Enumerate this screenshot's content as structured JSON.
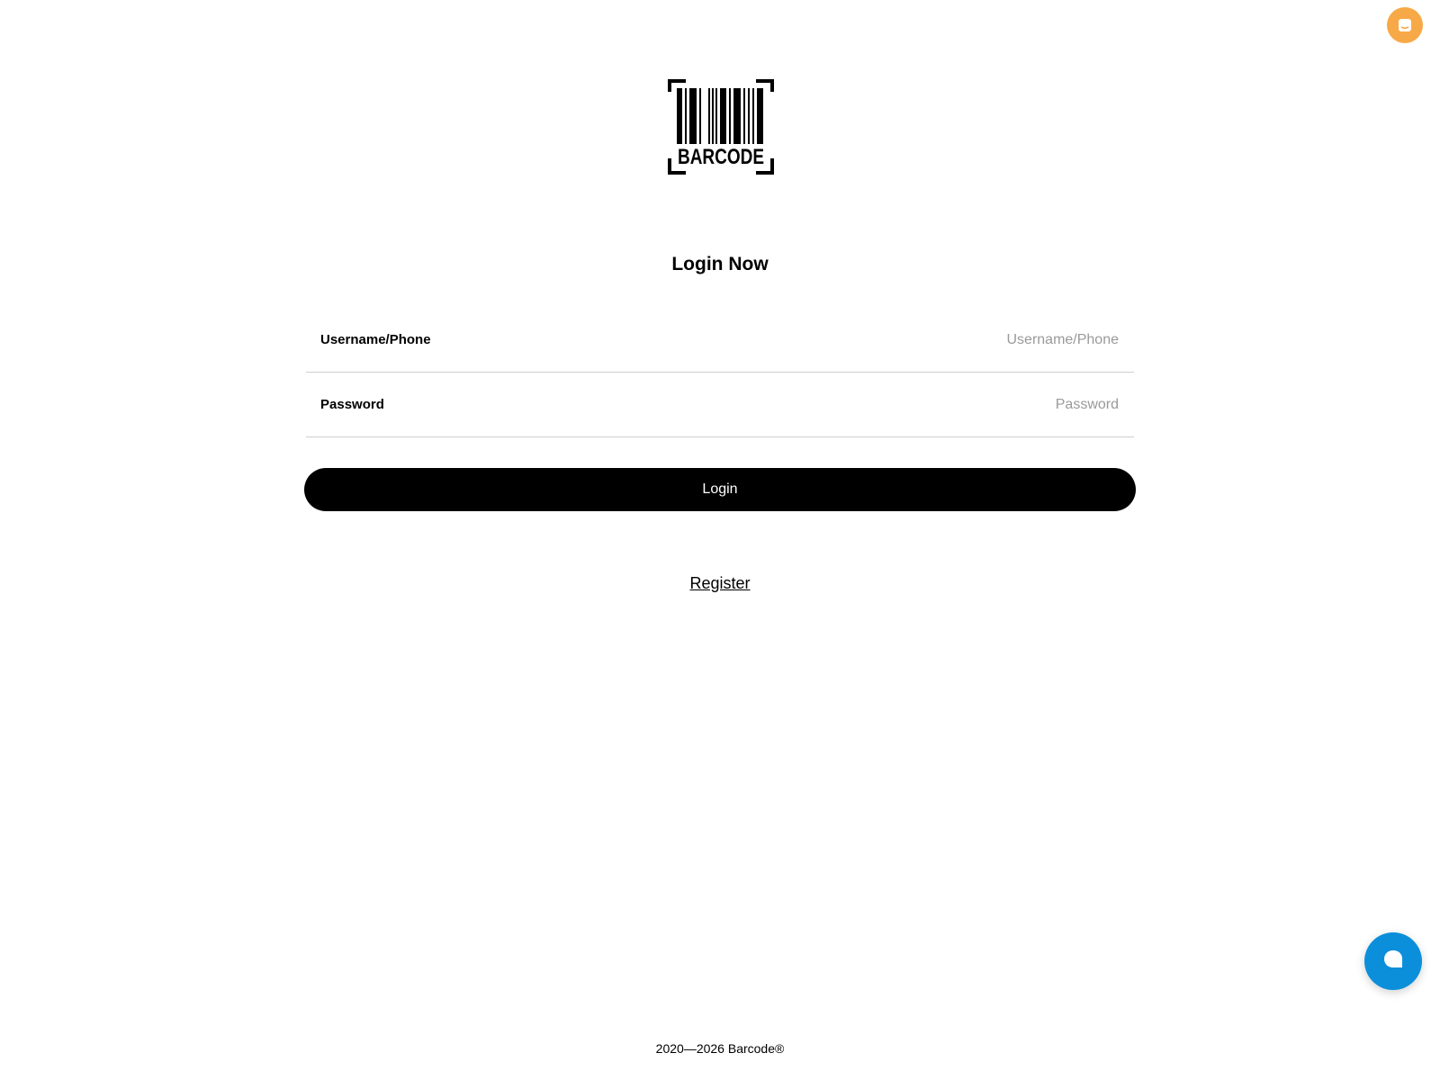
{
  "logo": {
    "text": "BARCODE"
  },
  "login": {
    "title": "Login Now",
    "username_label": "Username/Phone",
    "username_placeholder": "Username/Phone",
    "username_value": "",
    "password_label": "Password",
    "password_placeholder": "Password",
    "password_value": "",
    "submit_label": "Login",
    "register_label": "Register"
  },
  "footer": {
    "copyright": "2020—2026 Barcode®"
  },
  "widgets": {
    "top_button_icon": "message-icon",
    "top_button_color": "#f7a947",
    "chat_button_icon": "chat-bubble-icon",
    "chat_button_color": "#0c8fdb"
  }
}
